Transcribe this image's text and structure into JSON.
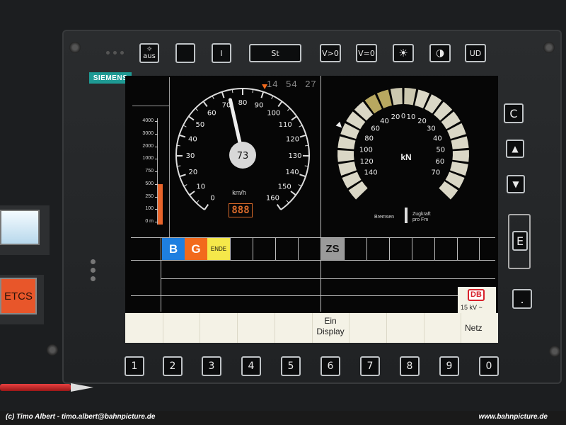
{
  "brand": "SIEMENS",
  "top_buttons": [
    {
      "label": "aus",
      "icon": "sun-icon"
    },
    {
      "label": ""
    },
    {
      "label": "I"
    },
    {
      "label": "St"
    },
    {
      "label": "V>0"
    },
    {
      "label": "V=0"
    },
    {
      "icon": "brightness-icon"
    },
    {
      "icon": "contrast-icon"
    },
    {
      "label": "UD"
    }
  ],
  "right_buttons": [
    "C",
    "▲",
    "▼",
    "E",
    "."
  ],
  "number_buttons": [
    "1",
    "2",
    "3",
    "4",
    "5",
    "6",
    "7",
    "8",
    "9",
    "0"
  ],
  "left_panel": {
    "etcs_label": "ETCS"
  },
  "distance_bar": {
    "ticks": [
      "4000",
      "3000",
      "2000",
      "1000",
      "750",
      "500",
      "250",
      "100",
      "0 m"
    ],
    "fill_fraction": 0.38
  },
  "speedometer": {
    "current_speed": "73",
    "unit": "km/h",
    "ticks": [
      "0",
      "10",
      "20",
      "30",
      "40",
      "50",
      "60",
      "70",
      "80",
      "90",
      "100",
      "110",
      "120",
      "130",
      "140",
      "150",
      "160"
    ],
    "max": 160,
    "value": 73,
    "target_marker": 90,
    "digital_readout": "888"
  },
  "clock": {
    "h": "14",
    "m": "54",
    "s": "27"
  },
  "force_gauge": {
    "unit": "kN",
    "brake_label": "Bremsen",
    "traction_label": "Zugkraft\npro Fm",
    "left_ticks": [
      "140",
      "120",
      "100",
      "80",
      "60",
      "40",
      "20"
    ],
    "center": "0",
    "right_ticks": [
      "10",
      "20",
      "30",
      "40",
      "50",
      "60",
      "70"
    ]
  },
  "indicators": {
    "b": "B",
    "g": "G",
    "ende": "ENDE",
    "zs": "ZS"
  },
  "colors": {
    "b": "#1e7fe0",
    "g": "#f26a1c",
    "ende": "#f5e84a",
    "zs": "#9a9a9a",
    "screen_bg": "#060606",
    "status_bg": "#f4f2e6"
  },
  "status_bar": {
    "line1": "Ein",
    "line2": "Display",
    "netz": "Netz",
    "db_logo": "DB",
    "voltage": "15 kV"
  },
  "footer": {
    "left": "(c) Timo Albert - timo.albert@bahnpicture.de",
    "right": "www.bahnpicture.de"
  }
}
